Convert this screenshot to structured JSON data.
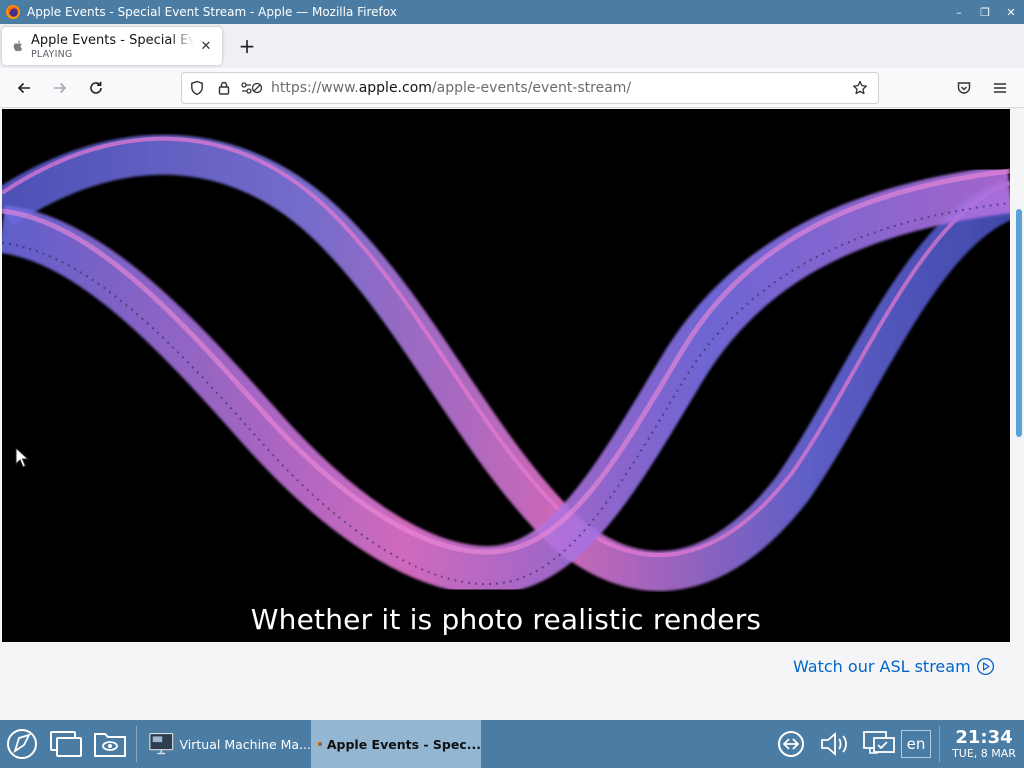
{
  "window": {
    "title": "Apple Events - Special Event Stream - Apple — Mozilla Firefox",
    "controls": {
      "minimize": "–",
      "maximize": "❐",
      "close": "✕"
    }
  },
  "tabs": [
    {
      "title": "Apple Events - Special Event Stream - Apple",
      "status": "PLAYING",
      "close": "✕"
    }
  ],
  "new_tab_label": "+",
  "navbar": {
    "url_scheme": "https://www.",
    "url_host": "apple.com",
    "url_path": "/apple-events/event-stream/"
  },
  "page": {
    "caption": "Whether it is photo realistic renders",
    "asl_link": "Watch our ASL stream"
  },
  "taskbar": {
    "tasks": [
      {
        "label": "Virtual Machine Ma..."
      },
      {
        "label": "Apple Events - Spec..."
      }
    ],
    "language": "en",
    "time": "21:34",
    "date": "TUE, 8 MAR"
  },
  "colors": {
    "titlebar": "#4b7ca3",
    "link": "#0066cc",
    "ribbon_blue": "#6f6fe8",
    "ribbon_pink": "#f07ad8"
  }
}
